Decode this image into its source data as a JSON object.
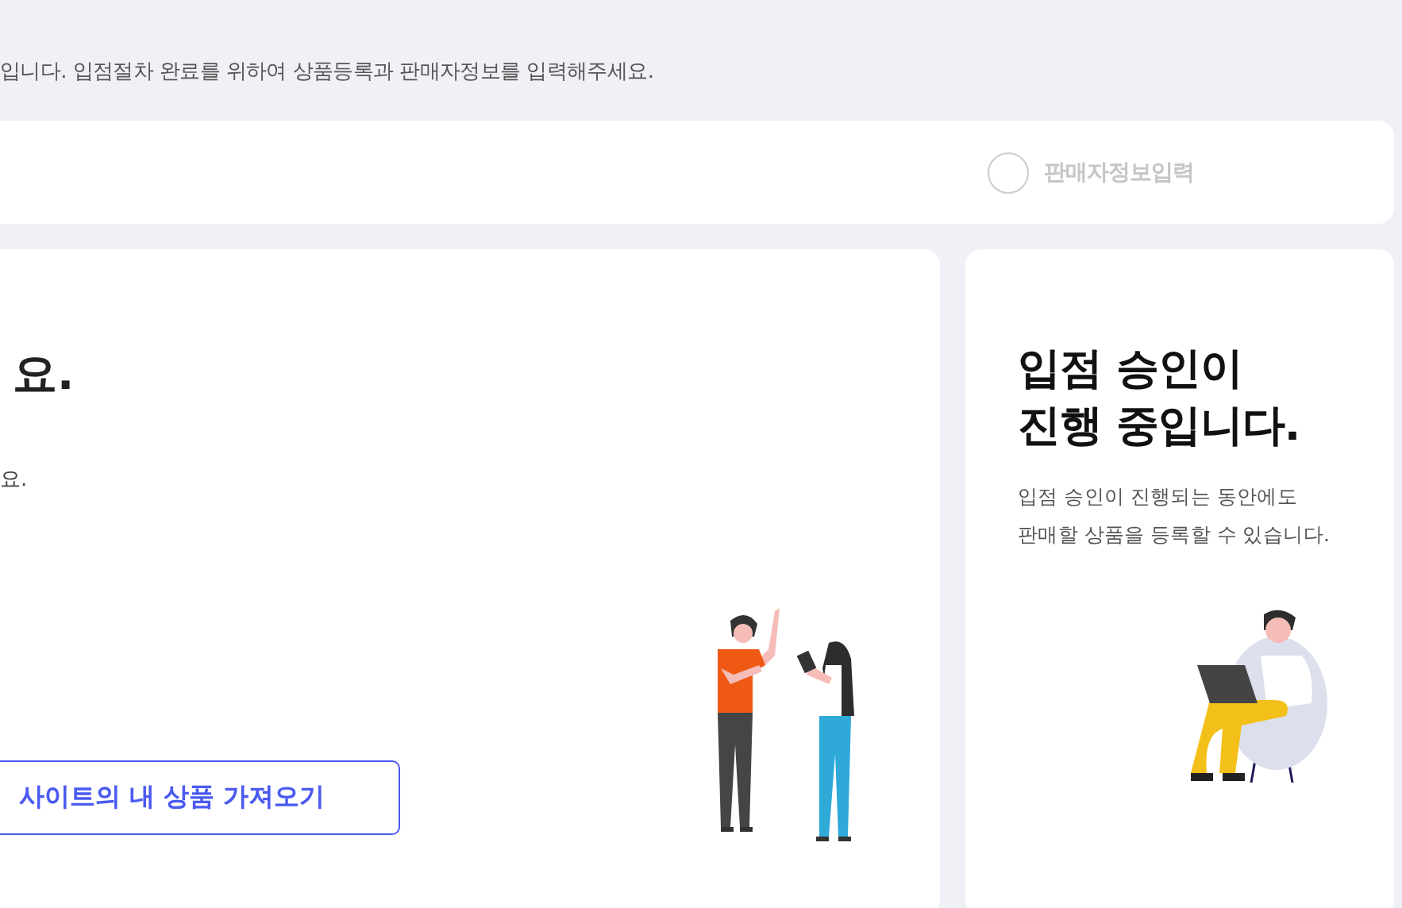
{
  "notice": "입니다. 입점절차 완료를 위하여 상품등록과 판매자정보를 입력해주세요.",
  "steps": [
    {
      "label": "판매자정보입력",
      "done": false
    }
  ],
  "main_card": {
    "heading": "요.",
    "description": "요.",
    "button": "사이트의 내 상품 가져오기"
  },
  "side_card": {
    "heading_lines": [
      "입점 승인이",
      "진행 중입니다."
    ],
    "description": "입점 승인이 진행되는 동안에도 판매할 상품을 등록할 수 있습니다."
  }
}
